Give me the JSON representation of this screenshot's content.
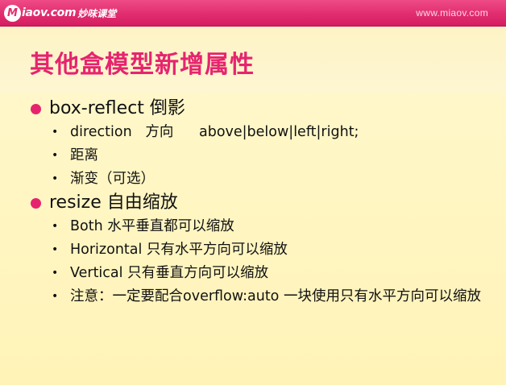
{
  "header": {
    "logo_mark": "M",
    "logo_text": "iaov.com",
    "logo_cn": "妙味课堂",
    "site_url": "www.miaov.com"
  },
  "slide": {
    "title": "其他盒模型新增属性",
    "sections": [
      {
        "label": "box-reflect 倒影",
        "items": [
          {
            "name": "direction",
            "desc": "方向",
            "value": "above|below|left|right;"
          },
          {
            "text": "距离"
          },
          {
            "text": "渐变（可选）"
          }
        ]
      },
      {
        "label": "resize 自由缩放",
        "items": [
          {
            "text": "Both 水平垂直都可以缩放"
          },
          {
            "text": "Horizontal 只有水平方向可以缩放"
          },
          {
            "text": "Vertical 只有垂直方向可以缩放"
          },
          {
            "text": "注意：一定要配合overflow:auto 一块使用只有水平方向可以缩放"
          }
        ]
      }
    ]
  },
  "colors": {
    "accent": "#e6246e",
    "header_bar": "#e12d6f",
    "background": "#fff8cc"
  }
}
